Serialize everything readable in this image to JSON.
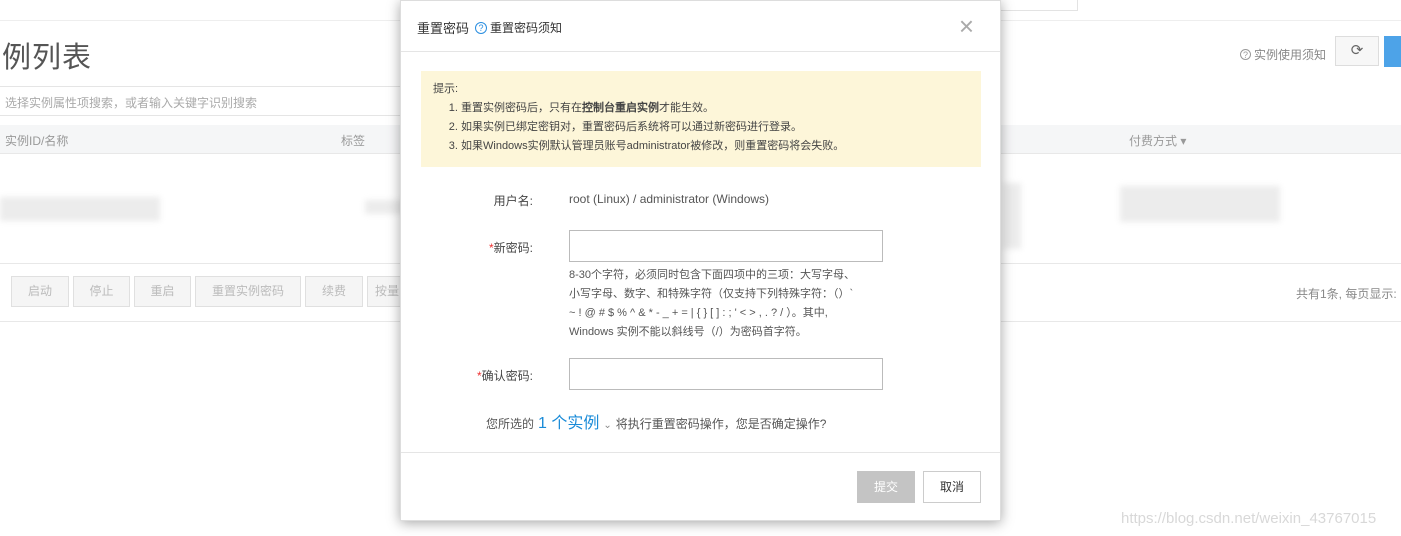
{
  "background": {
    "page_title": "例列表",
    "usage_notice": "实例使用须知",
    "search_placeholder": "选择实例属性项搜索，或者输入关键字识别搜索",
    "columns": [
      "实例ID/名称",
      "标签",
      "付费方式"
    ],
    "buttons": [
      "启动",
      "停止",
      "重启",
      "重置实例密码",
      "续费",
      "按量"
    ],
    "count_text": "共有1条, 每页显示:"
  },
  "modal": {
    "title": "重置密码",
    "help_link": "重置密码须知",
    "close_glyph": "×",
    "tips_title": "提示:",
    "tips": [
      {
        "pre": "重置实例密码后，只有在",
        "bold": "控制台重启实例",
        "post": "才能生效。"
      },
      {
        "pre": "如果实例已绑定密钥对，重置密码后系统将可以通过新密码进行登录。",
        "bold": "",
        "post": ""
      },
      {
        "pre": "如果Windows实例默认管理员账号administrator被修改，则重置密码将会失败。",
        "bold": "",
        "post": ""
      }
    ],
    "username_label": "用户名:",
    "username_value": "root (Linux) / administrator (Windows)",
    "new_password_label": "新密码:",
    "new_password_value": "",
    "password_hint": [
      "8-30个字符，必须同时包含下面四项中的三项：大写字母、",
      "小写字母、数字、和特殊字符（仅支持下列特殊字符：（）`",
      "~ ! @ # $ % ^ & * - _ + = | { } [ ] : ; ' < > , . ? / ）。其中,",
      "Windows 实例不能以斜线号（/）为密码首字符。"
    ],
    "confirm_password_label": "确认密码:",
    "confirm_password_value": "",
    "required_mark": "*",
    "confirm_prefix": "您所选的",
    "confirm_count": "1 个实例",
    "confirm_suffix": "将执行重置密码操作，您是否确定操作?",
    "submit_label": "提交",
    "cancel_label": "取消"
  },
  "watermark": "https://blog.csdn.net/weixin_43767015",
  "colors": {
    "accent": "#1a8bd8",
    "tip_bg": "#fdf6d9",
    "required": "#e33333"
  }
}
